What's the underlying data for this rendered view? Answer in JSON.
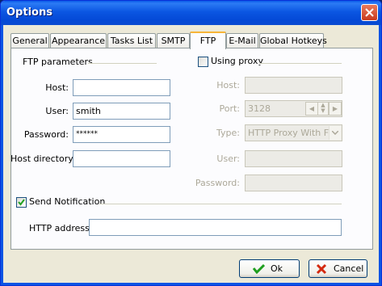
{
  "window": {
    "title": "Options"
  },
  "tabs": [
    {
      "label": "General"
    },
    {
      "label": "Appearance"
    },
    {
      "label": "Tasks List"
    },
    {
      "label": "SMTP"
    },
    {
      "label": "FTP",
      "active": true
    },
    {
      "label": "E-Mail"
    },
    {
      "label": "Global Hotkeys"
    }
  ],
  "ftp": {
    "group_label": "FTP parameters",
    "host": {
      "label": "Host:",
      "value": ""
    },
    "user": {
      "label": "User:",
      "value": "smith"
    },
    "password": {
      "label": "Password:",
      "value": "******"
    },
    "host_directory": {
      "label": "Host directory:",
      "value": ""
    }
  },
  "proxy": {
    "checkbox_label": "Using proxy",
    "checked": false,
    "host": {
      "label": "Host:",
      "value": ""
    },
    "port": {
      "label": "Port:",
      "value": "3128"
    },
    "type": {
      "label": "Type:",
      "value": "HTTP Proxy With FT"
    },
    "user": {
      "label": "User:",
      "value": ""
    },
    "password": {
      "label": "Password:",
      "value": ""
    }
  },
  "notification": {
    "checkbox_label": "Send Notification",
    "checked": true,
    "http_address": {
      "label": "HTTP address:",
      "value": ""
    }
  },
  "buttons": {
    "ok_label": "Ok",
    "cancel_label": "Cancel"
  }
}
